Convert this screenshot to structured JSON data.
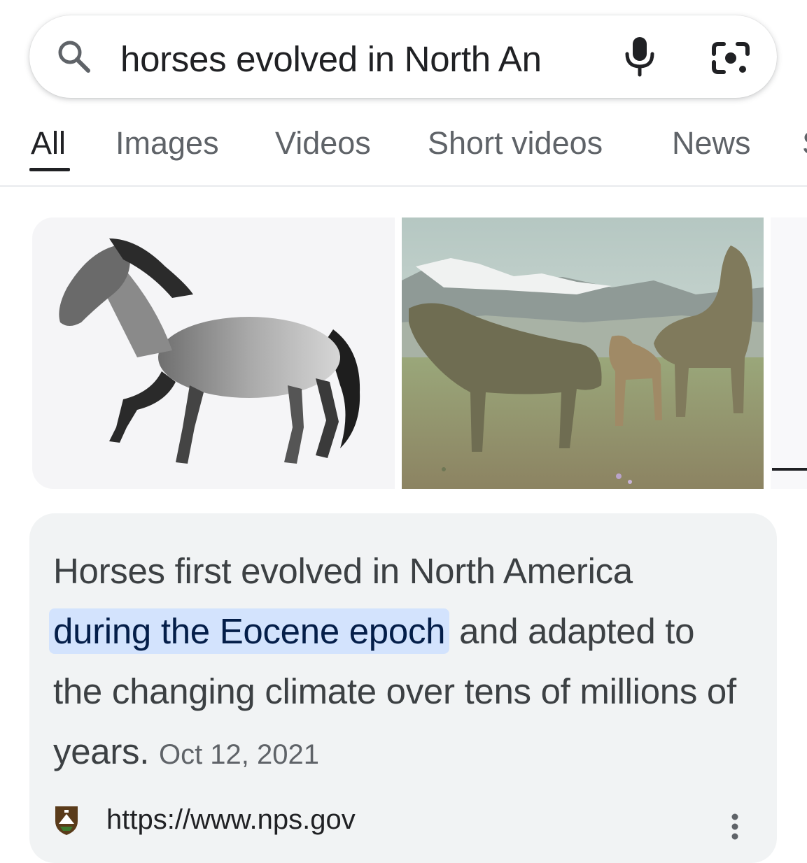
{
  "search": {
    "query": "horses evolved in North An",
    "icons": [
      "search-icon",
      "mic-icon",
      "lens-icon"
    ]
  },
  "tabs": [
    {
      "label": "All",
      "active": true
    },
    {
      "label": "Images",
      "active": false
    },
    {
      "label": "Videos",
      "active": false
    },
    {
      "label": "Short videos",
      "active": false
    },
    {
      "label": "News",
      "active": false
    }
  ],
  "images": [
    {
      "name": "horse-illustration"
    },
    {
      "name": "ancient-horses-landscape"
    },
    {
      "name": "partial-image"
    }
  ],
  "snippet": {
    "text_before": "Horses first evolved in North America ",
    "highlight": "during the Eocene epoch",
    "text_after": " and adapted to the changing climate over tens of millions of years.",
    "date": "Oct 12, 2021",
    "source_url": "https://www.nps.gov"
  },
  "colors": {
    "highlight_bg": "#d3e3fd",
    "snippet_bg": "#f1f3f4",
    "muted_text": "#5f6368"
  }
}
